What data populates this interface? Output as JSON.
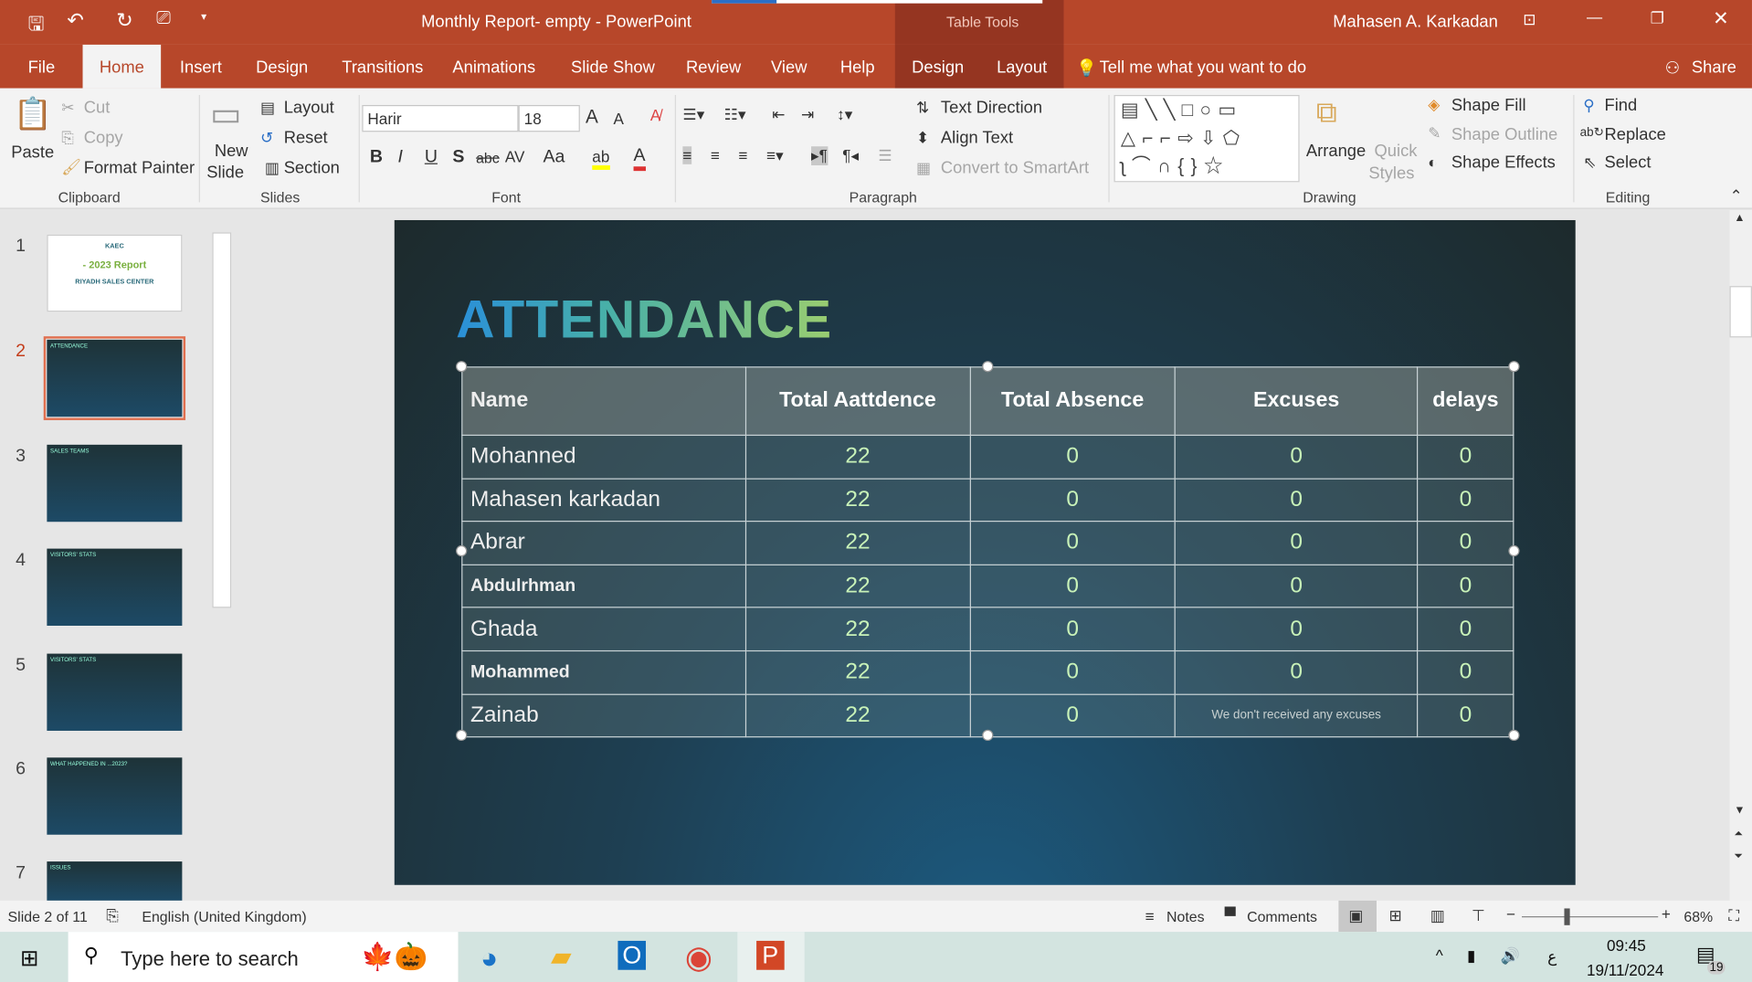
{
  "title_bar": {
    "doc_title": "Monthly Report- empty  -  PowerPoint",
    "context": "Table Tools",
    "user": "Mahasen A. Karkadan"
  },
  "tabs": [
    "File",
    "Home",
    "Insert",
    "Design",
    "Transitions",
    "Animations",
    "Slide Show",
    "Review",
    "View",
    "Help",
    "Design",
    "Layout"
  ],
  "tell_me": "Tell me what you want to do",
  "share": "Share",
  "ribbon": {
    "clipboard": {
      "paste": "Paste",
      "cut": "Cut",
      "copy": "Copy",
      "format_painter": "Format Painter",
      "group": "Clipboard"
    },
    "slides": {
      "new_slide": "New",
      "new_slide2": "Slide",
      "layout": "Layout",
      "reset": "Reset",
      "section": "Section",
      "group": "Slides"
    },
    "font": {
      "name": "Harir",
      "size": "18",
      "group": "Font",
      "bold": "B",
      "italic": "I",
      "underline": "U",
      "shadow": "S",
      "strike": "abc",
      "spacing": "AV",
      "case": "Aa",
      "grow": "A",
      "shrink": "A"
    },
    "paragraph": {
      "text_direction": "Text Direction",
      "align_text": "Align Text",
      "smartart": "Convert to SmartArt",
      "group": "Paragraph"
    },
    "drawing": {
      "arrange": "Arrange",
      "quick": "Quick",
      "styles": "Styles",
      "fill": "Shape Fill",
      "outline": "Shape Outline",
      "effects": "Shape Effects",
      "group": "Drawing"
    },
    "editing": {
      "find": "Find",
      "replace": "Replace",
      "select": "Select",
      "group": "Editing"
    }
  },
  "thumbnails": [
    {
      "n": "1",
      "lines": [
        "KAEC",
        "- 2023 Report",
        "RIYADH SALES CENTER"
      ]
    },
    {
      "n": "2",
      "lines": [
        "ATTENDANCE"
      ]
    },
    {
      "n": "3",
      "lines": [
        "SALES TEAMS"
      ]
    },
    {
      "n": "4",
      "lines": [
        "VISITORS' STATS"
      ]
    },
    {
      "n": "5",
      "lines": [
        "VISITORS' STATS"
      ]
    },
    {
      "n": "6",
      "lines": [
        "WHAT HAPPENED IN ...2023?"
      ]
    },
    {
      "n": "7",
      "lines": [
        "ISSUES"
      ]
    }
  ],
  "slide": {
    "title": "ATTENDANCE",
    "headers": [
      "Name",
      "Total Aattdence",
      "Total Absence",
      "Excuses",
      "delays"
    ],
    "rows": [
      [
        "Mohanned",
        "22",
        "0",
        "0",
        "0"
      ],
      [
        "Mahasen karkadan",
        "22",
        "0",
        "0",
        "0"
      ],
      [
        "Abrar",
        "22",
        "0",
        "0",
        "0"
      ],
      [
        "Abdulrhman",
        "22",
        "0",
        "0",
        "0"
      ],
      [
        "Ghada",
        "22",
        "0",
        "0",
        "0"
      ],
      [
        "Mohammed",
        "22",
        "0",
        "0",
        "0"
      ],
      [
        "Zainab",
        "22",
        "0",
        "We don't received any excuses",
        "0"
      ]
    ]
  },
  "status": {
    "slide": "Slide 2 of 11",
    "lang": "English (United Kingdom)",
    "notes": "Notes",
    "comments": "Comments",
    "zoom": "68%",
    "zoom_percent": 68
  },
  "taskbar": {
    "search": "Type here to search",
    "time": "09:45",
    "date": "19/11/2024",
    "notif": "19",
    "ime": "ع"
  },
  "colors": {
    "accent": "#b7472a",
    "table_number": "#c8f2b8"
  }
}
